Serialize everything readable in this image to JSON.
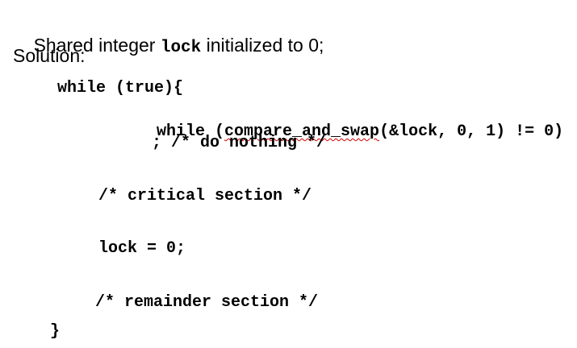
{
  "intro": {
    "line1_before": "Shared integer ",
    "line1_code": "lock",
    "line1_after": " initialized to 0;",
    "line2": "Solution:"
  },
  "code": {
    "outer_while": "while (true){",
    "inner_while_prefix": "while (",
    "inner_while_func": "compare_and_swap",
    "inner_while_suffix": "(&lock, 0, 1) != 0)",
    "do_nothing": "; /* do nothing */",
    "critical": "/* critical section */",
    "release": "lock = 0;",
    "remainder": "/* remainder section */",
    "closing_brace": "}"
  },
  "colors": {
    "spellcheck_underline": "#d00000"
  }
}
